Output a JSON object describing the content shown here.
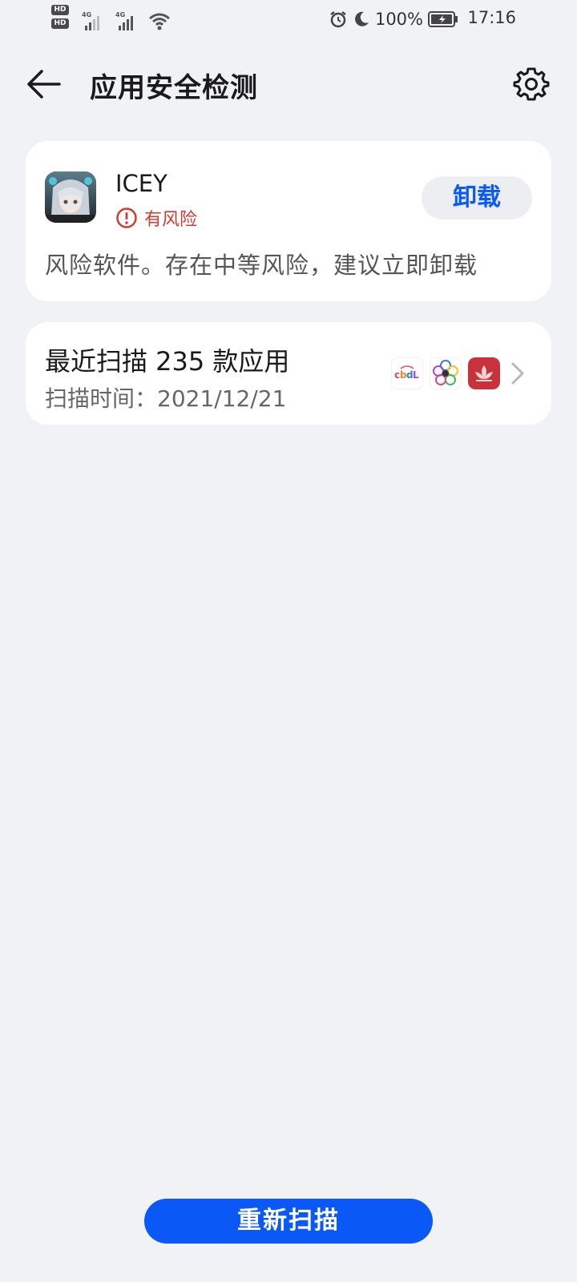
{
  "status_bar": {
    "sim1": "HD",
    "sim2": "HD",
    "sim1_index": "1",
    "sim2_index": "2",
    "net1": "4G",
    "net2": "4G",
    "battery_pct": "100%",
    "time": "17:16"
  },
  "header": {
    "title": "应用安全检测",
    "back_icon": "arrow-left-icon",
    "settings_icon": "gear-icon"
  },
  "risk_card": {
    "app_name": "ICEY",
    "risk_label": "有风险",
    "uninstall_label": "卸载",
    "description": "风险软件。存在中等风险，建议立即卸载"
  },
  "scan_card": {
    "title": "最近扫描 235 款应用",
    "scan_time": "扫描时间：2021/12/21",
    "app_icons": [
      "cbdl-app-icon",
      "flower-app-icon",
      "lotus-app-icon"
    ]
  },
  "footer": {
    "rescan_label": "重新扫描"
  },
  "colors": {
    "accent": "#0a59f7",
    "risk": "#d23b2f",
    "background": "#f1f2f5",
    "card": "#ffffff"
  }
}
